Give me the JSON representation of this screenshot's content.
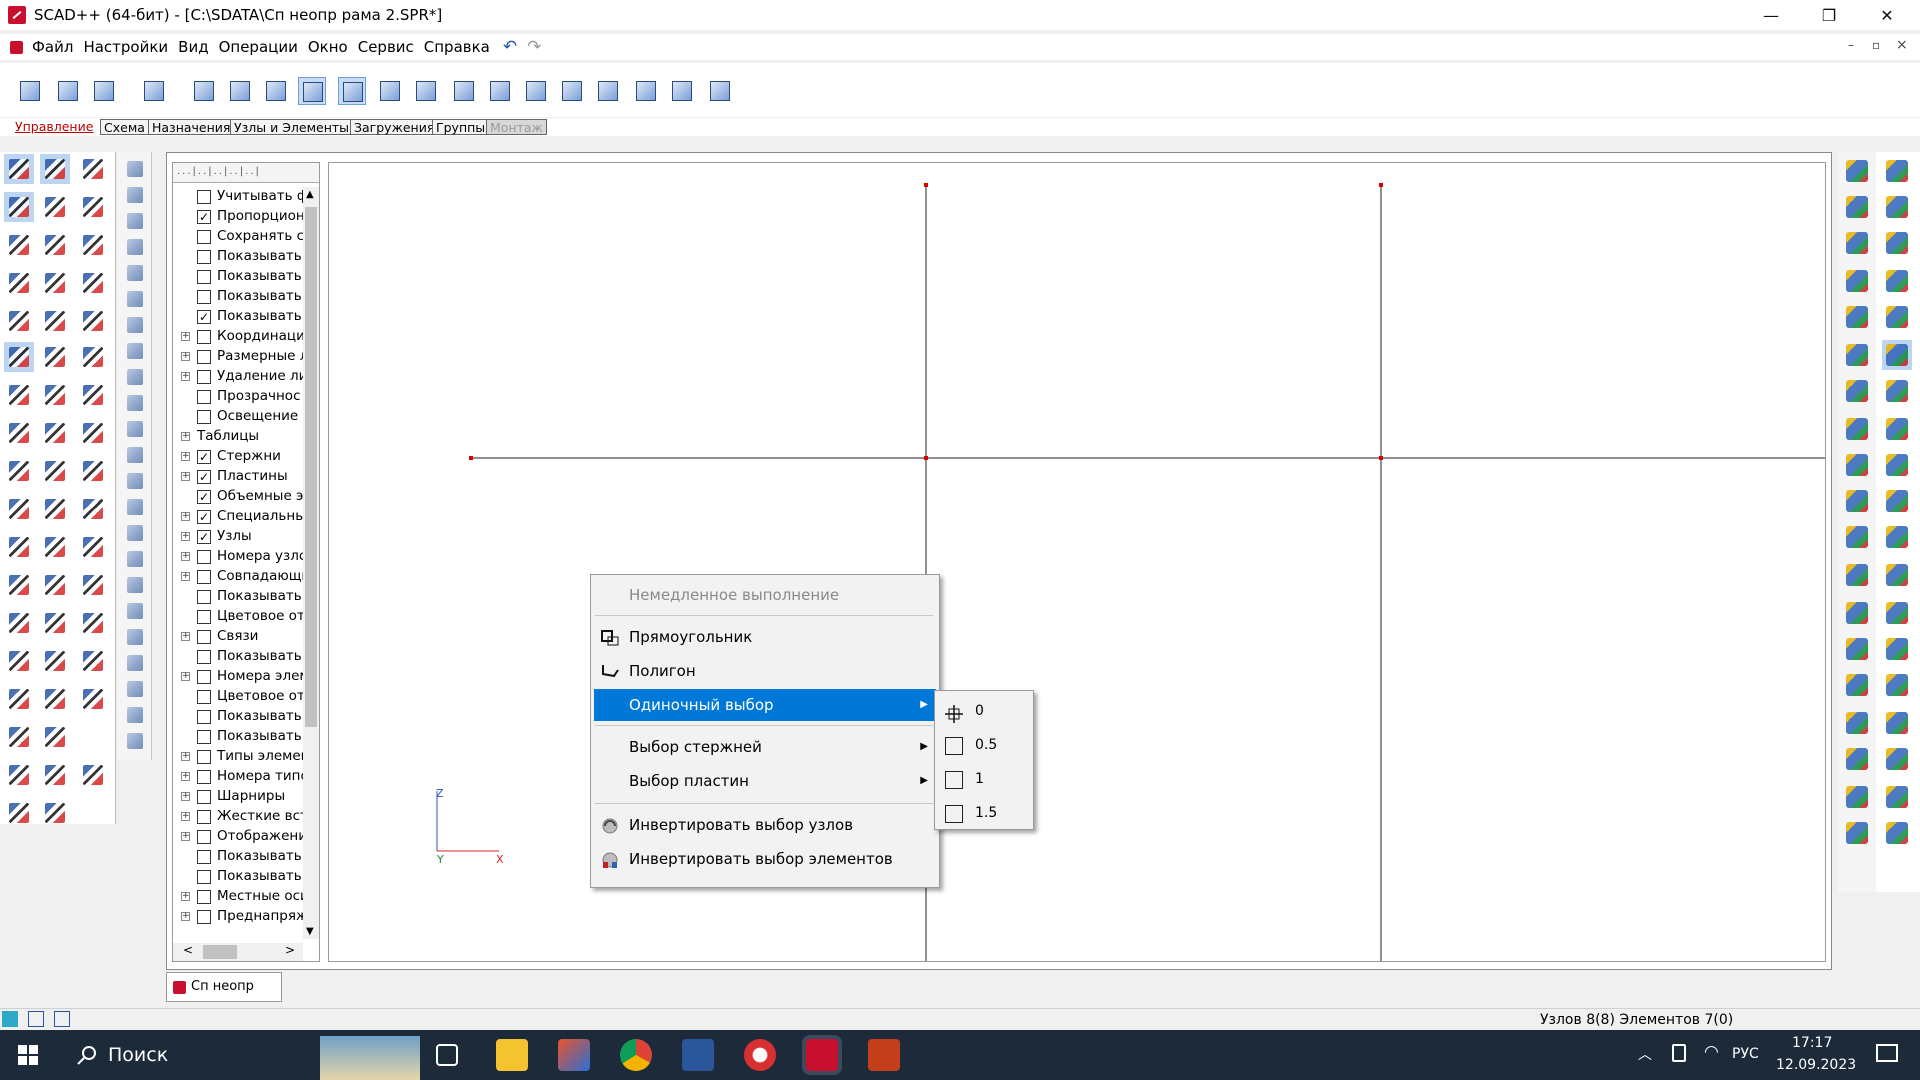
{
  "window": {
    "title": "SCAD++ (64-бит) - [C:\\SDATA\\Сп неопр рама 2.SPR*]",
    "minimize": "—",
    "restore": "❐",
    "close": "✕"
  },
  "menubar": {
    "items": [
      "Файл",
      "Настройки",
      "Вид",
      "Операции",
      "Окно",
      "Сервис",
      "Справка"
    ],
    "mdi_controls": [
      "–",
      "▫",
      "×"
    ]
  },
  "tabs": [
    "Управление",
    "Схема",
    "Назначения",
    "Узлы и Элементы",
    "Загружения",
    "Группы",
    "Монтаж"
  ],
  "tree": {
    "ruler": "...|..|..|..|..|",
    "rows": [
      {
        "label": "Учитывать ф",
        "exp": false,
        "cb": true,
        "checked": false
      },
      {
        "label": "Пропорцион",
        "exp": false,
        "cb": true,
        "checked": true
      },
      {
        "label": "Сохранять сс",
        "exp": false,
        "cb": true,
        "checked": false
      },
      {
        "label": "Показывать",
        "exp": false,
        "cb": true,
        "checked": false
      },
      {
        "label": "Показывать",
        "exp": false,
        "cb": true,
        "checked": false
      },
      {
        "label": "Показывать",
        "exp": false,
        "cb": true,
        "checked": false
      },
      {
        "label": "Показывать",
        "exp": false,
        "cb": true,
        "checked": true
      },
      {
        "label": "Координаци",
        "exp": true,
        "cb": true,
        "checked": false
      },
      {
        "label": "Размерные л",
        "exp": true,
        "cb": true,
        "checked": false
      },
      {
        "label": "Удаление ли",
        "exp": true,
        "cb": true,
        "checked": false
      },
      {
        "label": "Прозрачнос",
        "exp": false,
        "cb": true,
        "checked": false
      },
      {
        "label": "Освещение",
        "exp": false,
        "cb": true,
        "checked": false
      },
      {
        "label": "Таблицы",
        "exp": true,
        "cb": false,
        "checked": false
      },
      {
        "label": "Стержни",
        "exp": true,
        "cb": true,
        "checked": true
      },
      {
        "label": "Пластины",
        "exp": true,
        "cb": true,
        "checked": true
      },
      {
        "label": "Объемные эл",
        "exp": false,
        "cb": true,
        "checked": true
      },
      {
        "label": "Специальны",
        "exp": true,
        "cb": true,
        "checked": true
      },
      {
        "label": "Узлы",
        "exp": true,
        "cb": true,
        "checked": true
      },
      {
        "label": "Номера узлс",
        "exp": true,
        "cb": true,
        "checked": false
      },
      {
        "label": "Совпадающи",
        "exp": true,
        "cb": true,
        "checked": false
      },
      {
        "label": "Показывать",
        "exp": false,
        "cb": true,
        "checked": false
      },
      {
        "label": "Цветовое от",
        "exp": false,
        "cb": true,
        "checked": false
      },
      {
        "label": "Связи",
        "exp": true,
        "cb": true,
        "checked": false
      },
      {
        "label": "Показывать",
        "exp": false,
        "cb": true,
        "checked": false
      },
      {
        "label": "Номера элем",
        "exp": true,
        "cb": true,
        "checked": false
      },
      {
        "label": "Цветовое от",
        "exp": false,
        "cb": true,
        "checked": false
      },
      {
        "label": "Показывать",
        "exp": false,
        "cb": true,
        "checked": false
      },
      {
        "label": "Показывать",
        "exp": false,
        "cb": true,
        "checked": false
      },
      {
        "label": "Типы элемен",
        "exp": true,
        "cb": true,
        "checked": false
      },
      {
        "label": "Номера типс",
        "exp": true,
        "cb": true,
        "checked": false
      },
      {
        "label": "Шарниры",
        "exp": true,
        "cb": true,
        "checked": false
      },
      {
        "label": "Жесткие вст",
        "exp": true,
        "cb": true,
        "checked": false
      },
      {
        "label": "Отображени",
        "exp": true,
        "cb": true,
        "checked": false
      },
      {
        "label": "Показывать",
        "exp": false,
        "cb": true,
        "checked": false
      },
      {
        "label": "Показывать",
        "exp": false,
        "cb": true,
        "checked": false
      },
      {
        "label": "Местные оси",
        "exp": true,
        "cb": true,
        "checked": false
      },
      {
        "label": "Преднапряж",
        "exp": true,
        "cb": true,
        "checked": false
      }
    ],
    "scroll_up": "▲",
    "scroll_down": "▼",
    "scroll_left": "<",
    "scroll_right": ">"
  },
  "axes": {
    "z": "Z",
    "y": "Y",
    "x": "X"
  },
  "context_menu": {
    "items": [
      {
        "label": "Немедленное выполнение",
        "disabled": true
      },
      {
        "label": "Прямоугольник",
        "icon": "rectangle-select-icon"
      },
      {
        "label": "Полигон",
        "icon": "polygon-select-icon"
      },
      {
        "label": "Одиночный выбор",
        "highlighted": true,
        "submenu": true
      },
      {
        "label": "Выбор стержней",
        "submenu": true
      },
      {
        "label": "Выбор пластин",
        "submenu": true
      },
      {
        "label": "Инвертировать выбор узлов",
        "icon": "invert-nodes-icon"
      },
      {
        "label": "Инвертировать выбор  элементов",
        "icon": "invert-elements-icon"
      }
    ]
  },
  "submenu": {
    "items": [
      "0",
      "0.5",
      "1",
      "1.5"
    ]
  },
  "doc_tab": {
    "label": "Сп неопр ра..."
  },
  "statusbar": {
    "text": "Узлов 8(8) Элементов 7(0)"
  },
  "taskbar": {
    "search": "Поиск",
    "lang": "РУС",
    "time": "17:17",
    "date": "12.09.2023"
  },
  "colors": {
    "accent": "#0078d7",
    "active_tab": "#c00000",
    "node": "#e00000",
    "taskbar": "#1c2a3a"
  }
}
